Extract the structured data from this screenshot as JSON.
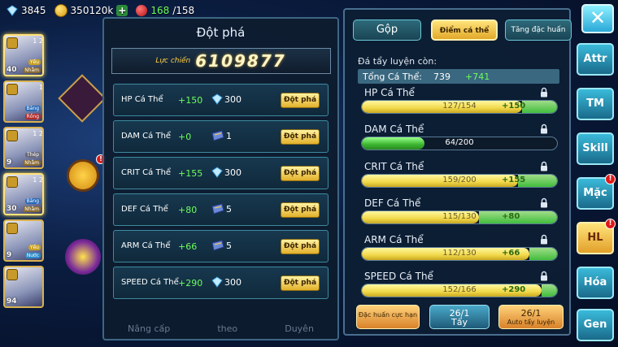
{
  "topbar": {
    "gems": "3845",
    "gold": "350120k",
    "stamina_current": "168",
    "stamina_max": "/158"
  },
  "heroes": [
    {
      "level": "40",
      "tag1": "Yếu",
      "tag2": "Nhẫm",
      "tag1_color": "#c8a020",
      "tag2_color": "#8a6a30",
      "stars": "1\n2",
      "selected": true
    },
    {
      "level": "",
      "tag1": "Băng",
      "tag2": "Rồng",
      "tag1_color": "#2a6ab8",
      "tag2_color": "#b02a2a",
      "stars": "1",
      "selected": false
    },
    {
      "level": "9",
      "tag1": "Thép",
      "tag2": "Nhẫm",
      "tag1_color": "#6a6a7a",
      "tag2_color": "#8a6a30",
      "stars": "1\n2",
      "selected": false
    },
    {
      "level": "30",
      "tag1": "Băng",
      "tag2": "Nhẫm",
      "tag1_color": "#2a6ab8",
      "tag2_color": "#8a6a30",
      "stars": "1\n2",
      "selected": true
    },
    {
      "level": "9",
      "tag1": "Yếu",
      "tag2": "Nước",
      "tag1_color": "#c8a020",
      "tag2_color": "#2a8ac8",
      "stars": "",
      "selected": false
    },
    {
      "level": "94",
      "tag1": "",
      "tag2": "",
      "tag1_color": "#000",
      "tag2_color": "#000",
      "stars": "",
      "selected": false
    }
  ],
  "dot_pha": {
    "title": "Đột phá",
    "power_label": "Lực chiến",
    "power_value": "6109877",
    "rows": [
      {
        "name": "HP Cá Thể",
        "plus": "+150",
        "cost_icon": "diamond-icon",
        "cost": "300",
        "button": "Đột phá"
      },
      {
        "name": "DAM Cá Thể",
        "plus": "+0",
        "cost_icon": "scroll-icon",
        "cost": "1",
        "button": "Đột phá"
      },
      {
        "name": "CRIT Cá Thể",
        "plus": "+155",
        "cost_icon": "diamond-icon",
        "cost": "300",
        "button": "Đột phá"
      },
      {
        "name": "DEF Cá Thể",
        "plus": "+80",
        "cost_icon": "scroll-icon",
        "cost": "5",
        "button": "Đột phá"
      },
      {
        "name": "ARM Cá Thể",
        "plus": "+66",
        "cost_icon": "scroll-icon",
        "cost": "5",
        "button": "Đột phá"
      },
      {
        "name": "SPEED Cá Thể",
        "plus": "+290",
        "cost_icon": "diamond-icon",
        "cost": "300",
        "button": "Đột phá"
      }
    ],
    "bottom_tabs": [
      "Nâng cấp",
      "theo",
      "Duyên"
    ]
  },
  "right_panel": {
    "tabs": [
      "Gộp",
      "Điểm cá thể",
      "Tăng đặc huấn"
    ],
    "remaining_label": "Đá tẩy luyện còn:",
    "total_label": "Tổng Cá Thể:",
    "total_value": "739",
    "total_plus": "+741",
    "stats": [
      {
        "name": "HP Cá Thể",
        "text": "127/154",
        "plus": "+150",
        "fill": 0.82,
        "gain_to": 1.0,
        "color": "yellow"
      },
      {
        "name": "DAM Cá Thể",
        "text": "64/200",
        "plus": "",
        "fill": 0.32,
        "gain_to": 0.32,
        "color": "green"
      },
      {
        "name": "CRIT Cá Thể",
        "text": "159/200",
        "plus": "+155",
        "fill": 0.8,
        "gain_to": 1.0,
        "color": "yellow"
      },
      {
        "name": "DEF Cá Thể",
        "text": "115/130",
        "plus": "+80",
        "fill": 0.6,
        "gain_to": 1.0,
        "color": "yellow"
      },
      {
        "name": "ARM Cá Thể",
        "text": "112/130",
        "plus": "+66",
        "fill": 0.86,
        "gain_to": 1.0,
        "color": "yellow"
      },
      {
        "name": "SPEED Cá Thể",
        "text": "152/166",
        "plus": "+290",
        "fill": 0.92,
        "gain_to": 1.0,
        "color": "yellow"
      }
    ],
    "btn_dac_huan": "Đặc huấn cực hạn",
    "btn_tay_count": "26/1",
    "btn_tay_label": "Tẩy",
    "btn_auto_count": "26/1",
    "btn_auto_label": "Auto tẩy luyện"
  },
  "side_menu": [
    {
      "label": "Attr",
      "badge": false,
      "highlight": false
    },
    {
      "label": "TM",
      "badge": false,
      "highlight": false
    },
    {
      "label": "Skill",
      "badge": false,
      "highlight": false
    },
    {
      "label": "Mặc",
      "badge": true,
      "highlight": false
    },
    {
      "label": "HL",
      "badge": true,
      "highlight": true
    },
    {
      "label": "Hóa",
      "badge": false,
      "highlight": false
    },
    {
      "label": "Gen",
      "badge": false,
      "highlight": false
    }
  ],
  "badge_text": "!",
  "close_glyph": "✕"
}
